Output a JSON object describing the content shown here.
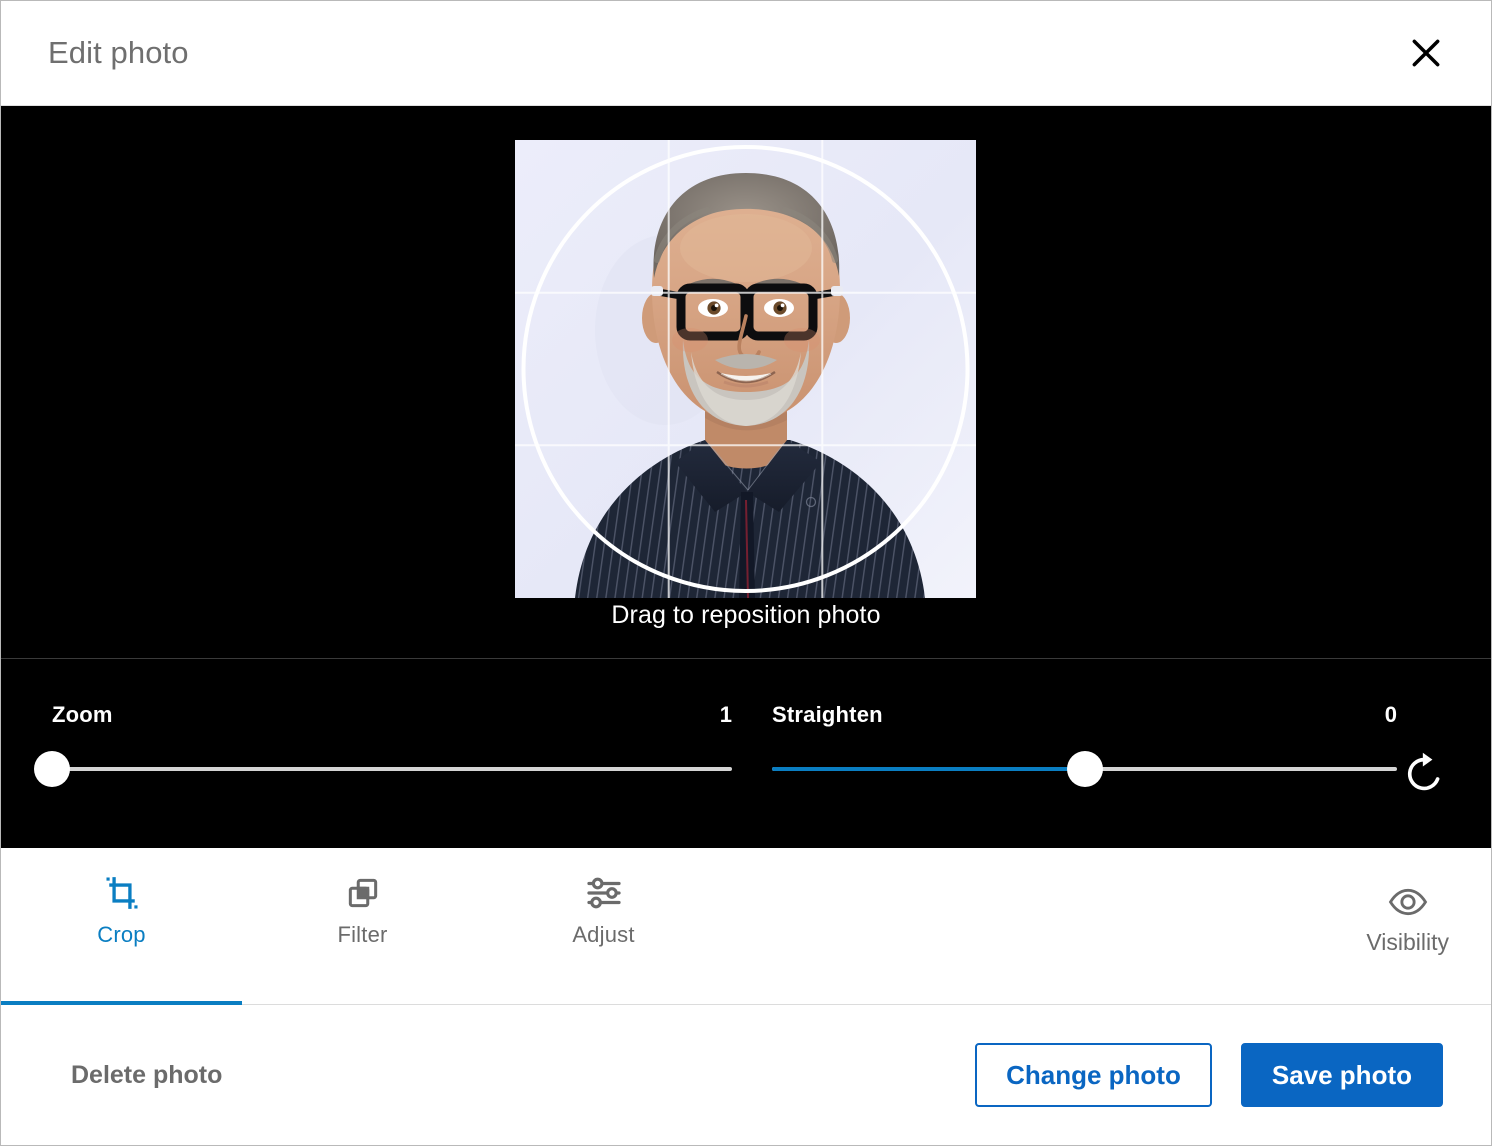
{
  "header": {
    "title": "Edit photo",
    "close_icon": "close-icon"
  },
  "stage": {
    "drag_hint": "Drag to reposition photo",
    "photo_alt": "Portrait of a smiling man with black-framed glasses, short gray hair and a gray beard, wearing a dark navy pinstriped collared shirt on a pale lavender background",
    "crop_shape": "circle",
    "grid": "rule-of-thirds"
  },
  "sliders": [
    {
      "name": "zoom",
      "label": "Zoom",
      "value": "1",
      "percent": 0,
      "fill_color": "#0a7ec2",
      "track_color": "#d4d4d4"
    },
    {
      "name": "straighten",
      "label": "Straighten",
      "value": "0",
      "percent": 50,
      "fill_color": "#0a7ec2",
      "track_color": "#d4d4d4"
    }
  ],
  "rotate": {
    "icon": "rotate-clockwise-icon"
  },
  "tools": {
    "tabs": [
      {
        "label": "Crop",
        "icon": "crop-icon",
        "active": true
      },
      {
        "label": "Filter",
        "icon": "filter-icon",
        "active": false
      },
      {
        "label": "Adjust",
        "icon": "adjust-sliders-icon",
        "active": false
      }
    ],
    "visibility": {
      "label": "Visibility",
      "icon": "eye-icon"
    }
  },
  "footer": {
    "delete_label": "Delete photo",
    "change_label": "Change photo",
    "save_label": "Save photo"
  },
  "colors": {
    "accent_blue": "#0a66c2",
    "slider_blue": "#0a7ec2",
    "stage_black": "#000000",
    "muted_gray": "#6b6b6b"
  }
}
